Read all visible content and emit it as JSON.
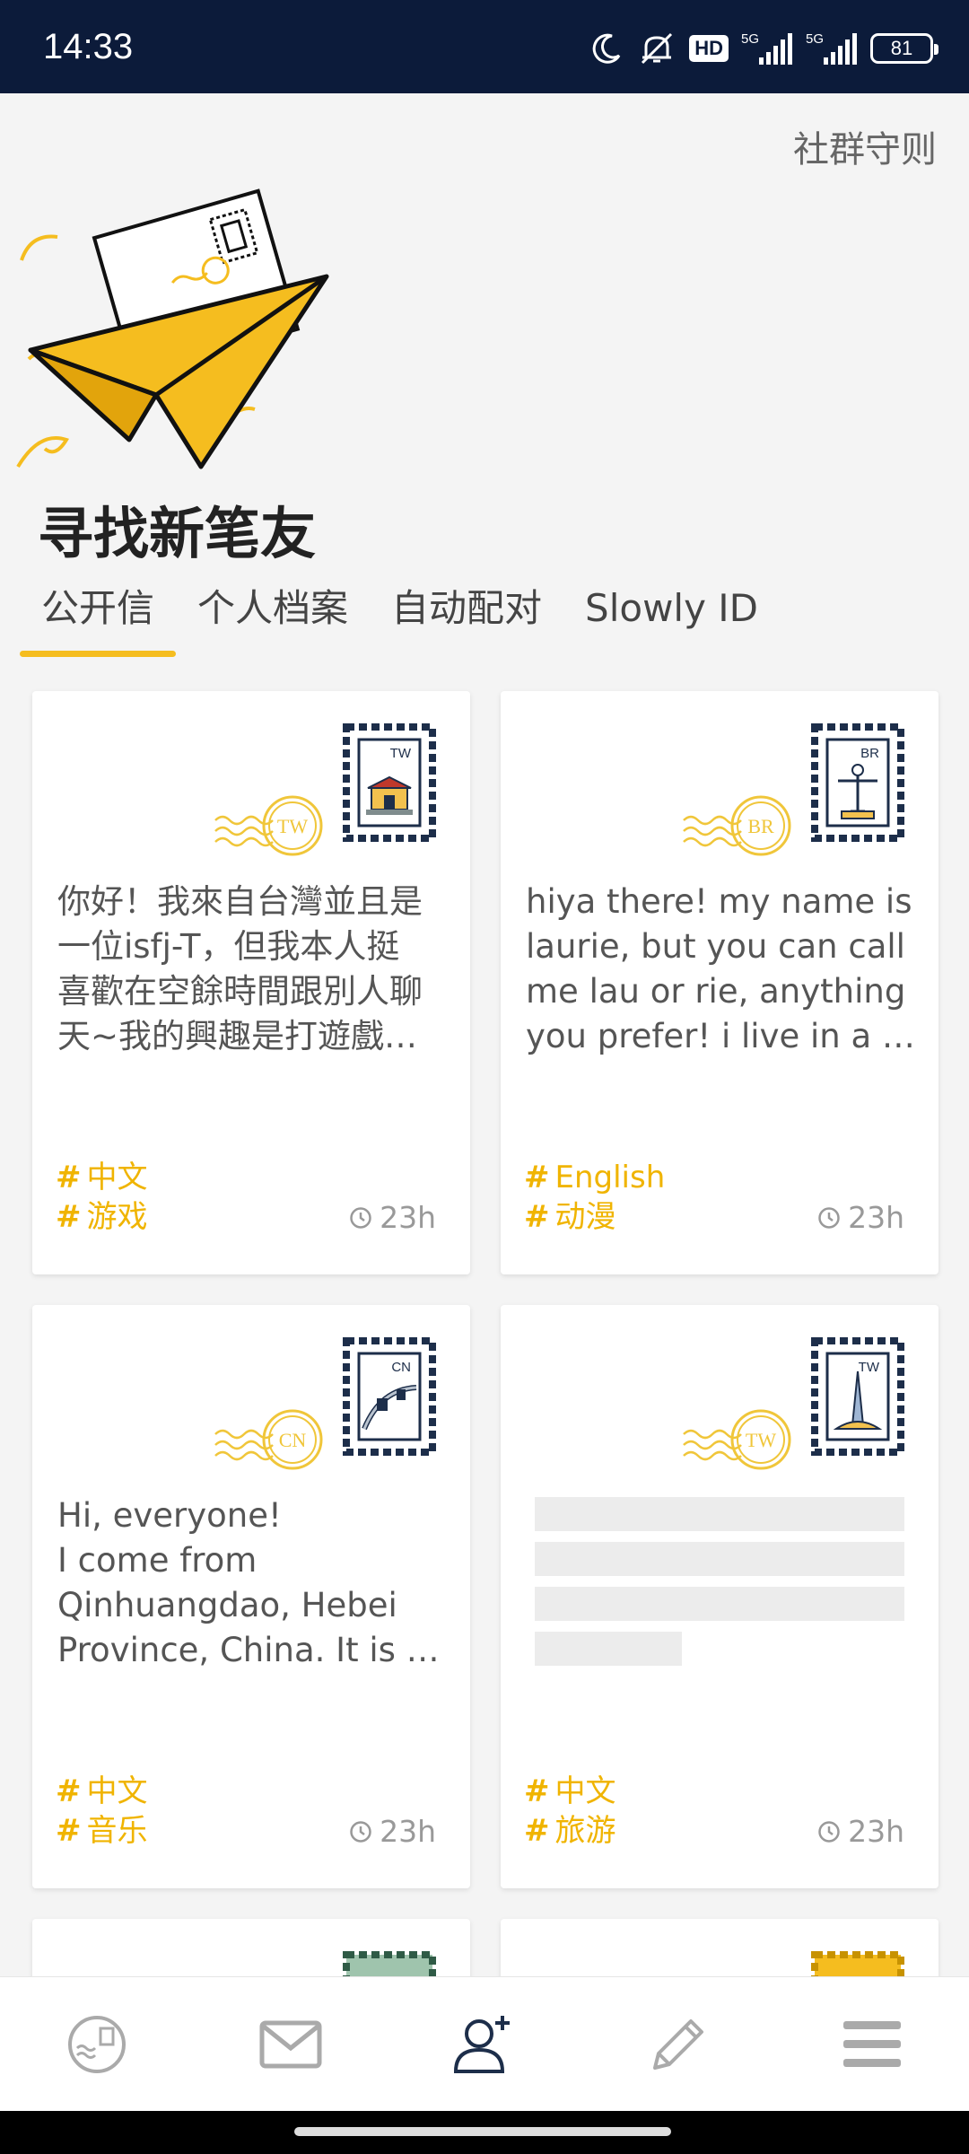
{
  "status_bar": {
    "time": "14:33",
    "network_1": "5G",
    "network_2": "5G",
    "hd_badge": "HD",
    "battery": "81",
    "icons": [
      "moon-icon",
      "mute-icon",
      "hd-icon",
      "signal-icon",
      "signal-icon",
      "battery-icon"
    ]
  },
  "header": {
    "rules_link": "社群守则",
    "title": "寻找新笔友"
  },
  "tabs": [
    {
      "label": "公开信",
      "active": true
    },
    {
      "label": "个人档案",
      "active": false
    },
    {
      "label": "自动配对",
      "active": false
    },
    {
      "label": "Slowly ID",
      "active": false
    }
  ],
  "cards": [
    {
      "country": "TW",
      "lines": [
        "你好！我來自台灣並且是",
        "一位isfj-T，但我本人挺",
        "喜歡在空餘時間跟別人聊",
        "天~我的興趣是打遊戲…"
      ],
      "tags": [
        "中文",
        "游戏"
      ],
      "time": "23h"
    },
    {
      "country": "BR",
      "lines": [
        "hiya there! my name is",
        "laurie, but you can call",
        "me lau or rie, anything",
        "you prefer! i live in a …"
      ],
      "tags": [
        "English",
        "动漫"
      ],
      "time": "23h"
    },
    {
      "country": "CN",
      "lines": [
        "Hi, everyone!",
        "I come from",
        "Qinhuangdao, Hebei",
        "Province, China. It is …"
      ],
      "tags": [
        "中文",
        "音乐"
      ],
      "time": "23h"
    },
    {
      "country": "TW",
      "lines": [],
      "tags": [
        "中文",
        "旅游"
      ],
      "time": "23h"
    }
  ],
  "bottom_nav": [
    {
      "icon": "stamp-collection-icon"
    },
    {
      "icon": "mail-icon"
    },
    {
      "icon": "add-friend-icon",
      "active": true
    },
    {
      "icon": "pencil-icon"
    },
    {
      "icon": "menu-icon"
    }
  ],
  "colors": {
    "status_bar_bg": "#0c1b3a",
    "accent": "#f5bd1f",
    "tag": "#f0b400",
    "stamp_navy": "#1d2e4a"
  }
}
